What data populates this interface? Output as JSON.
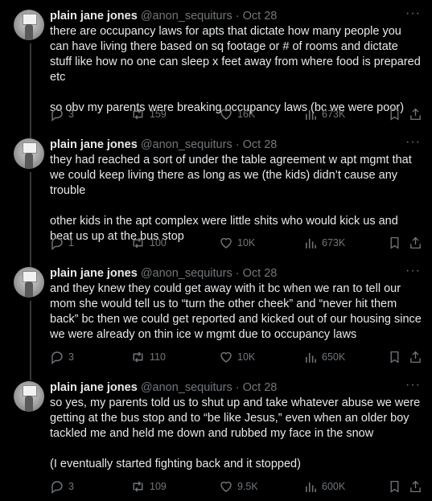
{
  "tweets": [
    {
      "name": "plain jane jones",
      "handle": "@anon_sequiturs",
      "dot": "·",
      "date": "Oct 28",
      "more": "···",
      "paragraphs": [
        "there are occupancy laws for apts that dictate how many people you can have living there based on sq footage or # of rooms and dictate stuff like how no one can sleep x feet away from where food is prepared etc",
        "so obv my parents were breaking occupancy laws (bc we were poor)"
      ],
      "stats": {
        "replies": "3",
        "retweets": "159",
        "likes": "16K",
        "views": "673K"
      }
    },
    {
      "name": "plain jane jones",
      "handle": "@anon_sequiturs",
      "dot": "·",
      "date": "Oct 28",
      "more": "···",
      "paragraphs": [
        "they had reached a sort of under the table agreement w apt mgmt that we could keep living there as long as we (the kids) didn’t cause any trouble",
        "other kids in the apt complex were little shits who would kick us and beat us up at the bus stop"
      ],
      "stats": {
        "replies": "1",
        "retweets": "100",
        "likes": "10K",
        "views": "673K"
      }
    },
    {
      "name": "plain jane jones",
      "handle": "@anon_sequiturs",
      "dot": "·",
      "date": "Oct 28",
      "more": "···",
      "paragraphs": [
        "and they knew they could get away with it bc when we ran to tell our mom she would tell us to “turn the other cheek” and “never hit them back” bc then we could get reported and kicked out of our housing since we were already on thin ice w mgmt due to occupancy laws"
      ],
      "stats": {
        "replies": "3",
        "retweets": "110",
        "likes": "10K",
        "views": "650K"
      }
    },
    {
      "name": "plain jane jones",
      "handle": "@anon_sequiturs",
      "dot": "·",
      "date": "Oct 28",
      "more": "···",
      "paragraphs": [
        "so yes, my parents told us to shut up and take whatever abuse we were getting at the bus stop and to “be like Jesus,” even when an older boy tackled me and held me down and rubbed my face in the snow",
        "(I eventually started fighting back and it stopped)"
      ],
      "stats": {
        "replies": "3",
        "retweets": "109",
        "likes": "9.5K",
        "views": "600K"
      }
    }
  ],
  "icons": {
    "reply": "reply-icon",
    "retweet": "retweet-icon",
    "like": "heart-icon",
    "views": "views-icon",
    "bookmark": "bookmark-icon",
    "share": "share-icon",
    "more": "more-icon"
  },
  "colors": {
    "background": "#000000",
    "text": "#e7e9ea",
    "muted": "#71767b",
    "thread_line": "#333639"
  }
}
